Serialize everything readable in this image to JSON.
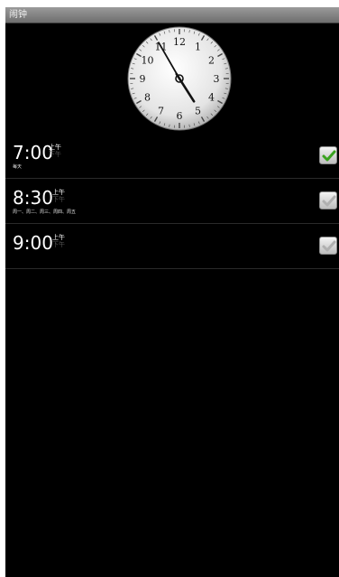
{
  "app": {
    "title": "闹钟"
  },
  "clock": {
    "hour_numerals": [
      "12",
      "1",
      "2",
      "3",
      "4",
      "5",
      "6",
      "7",
      "8",
      "9",
      "10",
      "11"
    ],
    "time_shown": "4:55"
  },
  "alarms": [
    {
      "time": "7:00",
      "am_label": "上午",
      "pm_label": "下午",
      "days": "每天",
      "enabled": true
    },
    {
      "time": "8:30",
      "am_label": "上午",
      "pm_label": "下午",
      "days": "周一、周二、周三、周四、周五",
      "enabled": false
    },
    {
      "time": "9:00",
      "am_label": "上午",
      "pm_label": "下午",
      "days": "",
      "enabled": false
    }
  ],
  "colors": {
    "check_on": "#3aa31f",
    "check_off": "#b0b0b0",
    "background": "#000000"
  }
}
